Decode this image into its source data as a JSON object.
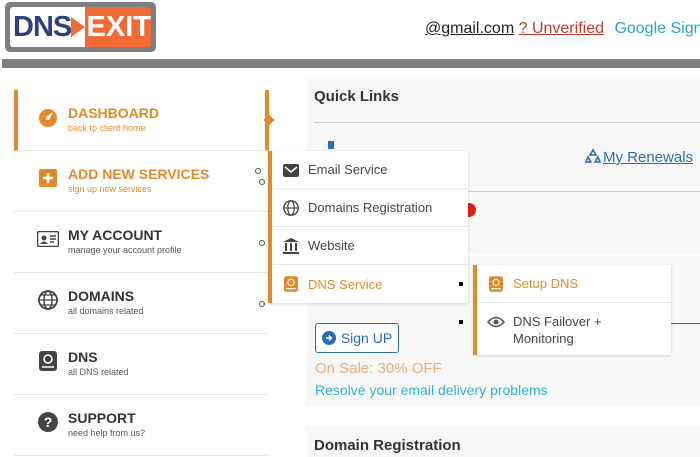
{
  "header": {
    "logo_left": "DNS",
    "logo_right": "EXIT",
    "email": "@gmail.com",
    "unverified": "? Unverified",
    "google_sign": "Google Sign"
  },
  "sidebar": {
    "items": [
      {
        "title": "DASHBOARD",
        "sub": "back to client home",
        "icon": "dashboard-gauge-icon"
      },
      {
        "title": "ADD NEW SERVICES",
        "sub": "sign up new services",
        "icon": "plus-square-icon"
      },
      {
        "title": "MY ACCOUNT",
        "sub": "manage your account profile",
        "icon": "id-card-icon"
      },
      {
        "title": "DOMAINS",
        "sub": "all domains related",
        "icon": "globe-icon"
      },
      {
        "title": "DNS",
        "sub": "all DNS related",
        "icon": "dns-book-icon"
      },
      {
        "title": "SUPPORT",
        "sub": "need help from us?",
        "icon": "question-circle-icon"
      }
    ]
  },
  "services_menu": {
    "items": [
      {
        "label": "Email Service",
        "icon": "envelope-icon"
      },
      {
        "label": "Domains Registration",
        "icon": "globe-icon"
      },
      {
        "label": "Website",
        "icon": "bank-building-icon"
      },
      {
        "label": "DNS Service",
        "icon": "dns-book-icon"
      }
    ]
  },
  "dns_menu": {
    "items": [
      {
        "label": "Setup DNS",
        "icon": "dns-book-icon"
      },
      {
        "label": "DNS Failover + Monitoring",
        "icon": "eye-icon"
      }
    ]
  },
  "main": {
    "quick_links_title": "Quick Links",
    "renewals_label": "My Renewals",
    "signup_label": "Sign UP",
    "sale_text": "On Sale: 30% OFF",
    "resolve_link": "Resolve your email delivery problems",
    "domain_registration_title": "Domain Registration"
  },
  "colors": {
    "accent": "#e28a2b",
    "link_blue": "#2a6db5",
    "teal": "#2fb3c4",
    "brand_orange": "#f26a35",
    "brand_navy": "#2f3f7f"
  }
}
